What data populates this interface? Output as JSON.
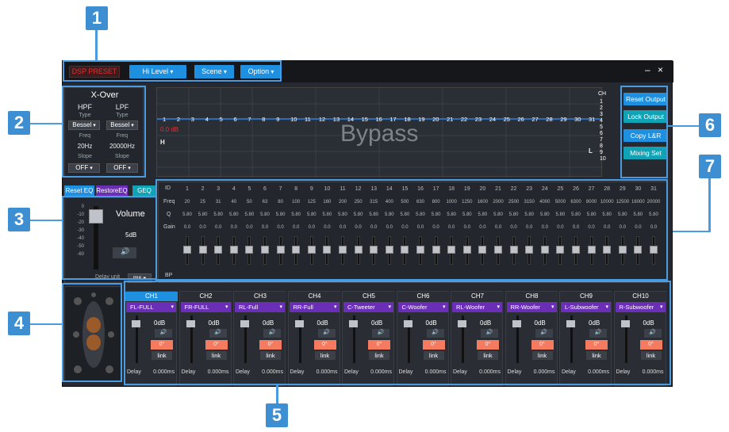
{
  "topbar": {
    "brand": "DSP PRESET",
    "menus": [
      "Hi Level",
      "Scene",
      "Option"
    ],
    "minimize": "–",
    "close": "×"
  },
  "xover": {
    "title": "X-Over",
    "hpf": "HPF",
    "lpf": "LPF",
    "type_label": "Type",
    "freq_label": "Freq",
    "slope_label": "Slope",
    "hpf_type": "Bessel",
    "lpf_type": "Bessel",
    "hpf_freq": "20Hz",
    "lpf_freq": "20000Hz",
    "hpf_slope": "OFF",
    "lpf_slope": "OFF"
  },
  "graph": {
    "bypass": "Bypass",
    "db_value": "0.0 dB",
    "h": "H",
    "l": "L",
    "band_numbers": [
      "1",
      "2",
      "3",
      "4",
      "5",
      "6",
      "7",
      "8",
      "9",
      "10",
      "11",
      "12",
      "13",
      "14",
      "15",
      "16",
      "17",
      "18",
      "19",
      "20",
      "21",
      "22",
      "23",
      "24",
      "25",
      "26",
      "27",
      "28",
      "29",
      "30",
      "31"
    ],
    "ch_label": "CH",
    "ch_numbers": [
      "1",
      "2",
      "3",
      "4",
      "5",
      "6",
      "7",
      "8",
      "9",
      "10"
    ]
  },
  "side_buttons": [
    "Reset Output",
    "Lock Output",
    "Copy L&R",
    "Mixing Set"
  ],
  "eq_tabs": [
    "Reset EQ",
    "RestoreEQ",
    "GEQ"
  ],
  "volume": {
    "label": "Volume",
    "db": "5dB",
    "delay_unit": "Delay unit",
    "unit": "ms",
    "scale": [
      "0",
      "-10",
      "-20",
      "-30",
      "-40",
      "-50",
      "-60"
    ]
  },
  "geq": {
    "row_labels": {
      "id": "ID",
      "freq": "Freq",
      "q": "Q",
      "gain": "Gain",
      "bp": "BP"
    },
    "freqs": [
      "20",
      "25",
      "31",
      "40",
      "50",
      "63",
      "80",
      "100",
      "125",
      "160",
      "200",
      "250",
      "315",
      "400",
      "500",
      "630",
      "800",
      "1000",
      "1250",
      "1600",
      "2000",
      "2500",
      "3150",
      "4000",
      "5000",
      "6300",
      "8000",
      "10000",
      "12500",
      "16000",
      "20000"
    ],
    "q": "5.80",
    "gain": "0.0"
  },
  "channels": [
    {
      "name": "CH1",
      "sel": "FL-FULL"
    },
    {
      "name": "CH2",
      "sel": "FR-FULL"
    },
    {
      "name": "CH3",
      "sel": "RL-Full"
    },
    {
      "name": "CH4",
      "sel": "RR-Full"
    },
    {
      "name": "CH5",
      "sel": "C-Tweeter"
    },
    {
      "name": "CH6",
      "sel": "C-Woofer"
    },
    {
      "name": "CH7",
      "sel": "RL-Woofer"
    },
    {
      "name": "CH8",
      "sel": "RR-Woofer"
    },
    {
      "name": "CH9",
      "sel": "L-Subwoofer"
    },
    {
      "name": "CH10",
      "sel": "R-Subwoofer"
    }
  ],
  "channel_common": {
    "db": "0dB",
    "phase": "0°",
    "link": "link",
    "delay": "Delay",
    "ms": "0.000ms"
  },
  "callouts": [
    "1",
    "2",
    "3",
    "4",
    "5",
    "6",
    "7"
  ],
  "colors": {
    "accent": "#1f8fe0",
    "purple": "#6b2eb7",
    "teal": "#11a3b5",
    "phase": "#f47a60",
    "callout": "#3d8fd1"
  }
}
